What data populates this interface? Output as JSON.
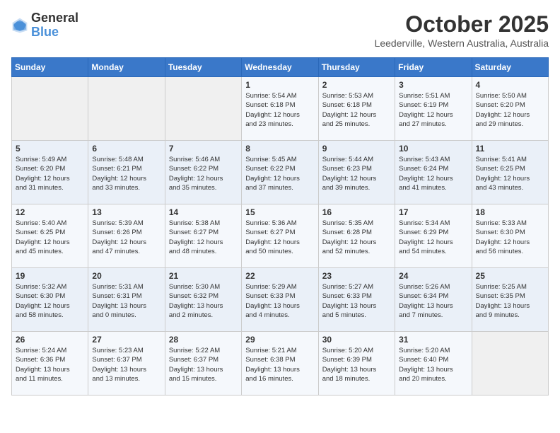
{
  "logo": {
    "text_general": "General",
    "text_blue": "Blue"
  },
  "header": {
    "month": "October 2025",
    "location": "Leederville, Western Australia, Australia"
  },
  "weekdays": [
    "Sunday",
    "Monday",
    "Tuesday",
    "Wednesday",
    "Thursday",
    "Friday",
    "Saturday"
  ],
  "weeks": [
    [
      {
        "day": "",
        "info": ""
      },
      {
        "day": "",
        "info": ""
      },
      {
        "day": "",
        "info": ""
      },
      {
        "day": "1",
        "info": "Sunrise: 5:54 AM\nSunset: 6:18 PM\nDaylight: 12 hours\nand 23 minutes."
      },
      {
        "day": "2",
        "info": "Sunrise: 5:53 AM\nSunset: 6:18 PM\nDaylight: 12 hours\nand 25 minutes."
      },
      {
        "day": "3",
        "info": "Sunrise: 5:51 AM\nSunset: 6:19 PM\nDaylight: 12 hours\nand 27 minutes."
      },
      {
        "day": "4",
        "info": "Sunrise: 5:50 AM\nSunset: 6:20 PM\nDaylight: 12 hours\nand 29 minutes."
      }
    ],
    [
      {
        "day": "5",
        "info": "Sunrise: 5:49 AM\nSunset: 6:20 PM\nDaylight: 12 hours\nand 31 minutes."
      },
      {
        "day": "6",
        "info": "Sunrise: 5:48 AM\nSunset: 6:21 PM\nDaylight: 12 hours\nand 33 minutes."
      },
      {
        "day": "7",
        "info": "Sunrise: 5:46 AM\nSunset: 6:22 PM\nDaylight: 12 hours\nand 35 minutes."
      },
      {
        "day": "8",
        "info": "Sunrise: 5:45 AM\nSunset: 6:22 PM\nDaylight: 12 hours\nand 37 minutes."
      },
      {
        "day": "9",
        "info": "Sunrise: 5:44 AM\nSunset: 6:23 PM\nDaylight: 12 hours\nand 39 minutes."
      },
      {
        "day": "10",
        "info": "Sunrise: 5:43 AM\nSunset: 6:24 PM\nDaylight: 12 hours\nand 41 minutes."
      },
      {
        "day": "11",
        "info": "Sunrise: 5:41 AM\nSunset: 6:25 PM\nDaylight: 12 hours\nand 43 minutes."
      }
    ],
    [
      {
        "day": "12",
        "info": "Sunrise: 5:40 AM\nSunset: 6:25 PM\nDaylight: 12 hours\nand 45 minutes."
      },
      {
        "day": "13",
        "info": "Sunrise: 5:39 AM\nSunset: 6:26 PM\nDaylight: 12 hours\nand 47 minutes."
      },
      {
        "day": "14",
        "info": "Sunrise: 5:38 AM\nSunset: 6:27 PM\nDaylight: 12 hours\nand 48 minutes."
      },
      {
        "day": "15",
        "info": "Sunrise: 5:36 AM\nSunset: 6:27 PM\nDaylight: 12 hours\nand 50 minutes."
      },
      {
        "day": "16",
        "info": "Sunrise: 5:35 AM\nSunset: 6:28 PM\nDaylight: 12 hours\nand 52 minutes."
      },
      {
        "day": "17",
        "info": "Sunrise: 5:34 AM\nSunset: 6:29 PM\nDaylight: 12 hours\nand 54 minutes."
      },
      {
        "day": "18",
        "info": "Sunrise: 5:33 AM\nSunset: 6:30 PM\nDaylight: 12 hours\nand 56 minutes."
      }
    ],
    [
      {
        "day": "19",
        "info": "Sunrise: 5:32 AM\nSunset: 6:30 PM\nDaylight: 12 hours\nand 58 minutes."
      },
      {
        "day": "20",
        "info": "Sunrise: 5:31 AM\nSunset: 6:31 PM\nDaylight: 13 hours\nand 0 minutes."
      },
      {
        "day": "21",
        "info": "Sunrise: 5:30 AM\nSunset: 6:32 PM\nDaylight: 13 hours\nand 2 minutes."
      },
      {
        "day": "22",
        "info": "Sunrise: 5:29 AM\nSunset: 6:33 PM\nDaylight: 13 hours\nand 4 minutes."
      },
      {
        "day": "23",
        "info": "Sunrise: 5:27 AM\nSunset: 6:33 PM\nDaylight: 13 hours\nand 5 minutes."
      },
      {
        "day": "24",
        "info": "Sunrise: 5:26 AM\nSunset: 6:34 PM\nDaylight: 13 hours\nand 7 minutes."
      },
      {
        "day": "25",
        "info": "Sunrise: 5:25 AM\nSunset: 6:35 PM\nDaylight: 13 hours\nand 9 minutes."
      }
    ],
    [
      {
        "day": "26",
        "info": "Sunrise: 5:24 AM\nSunset: 6:36 PM\nDaylight: 13 hours\nand 11 minutes."
      },
      {
        "day": "27",
        "info": "Sunrise: 5:23 AM\nSunset: 6:37 PM\nDaylight: 13 hours\nand 13 minutes."
      },
      {
        "day": "28",
        "info": "Sunrise: 5:22 AM\nSunset: 6:37 PM\nDaylight: 13 hours\nand 15 minutes."
      },
      {
        "day": "29",
        "info": "Sunrise: 5:21 AM\nSunset: 6:38 PM\nDaylight: 13 hours\nand 16 minutes."
      },
      {
        "day": "30",
        "info": "Sunrise: 5:20 AM\nSunset: 6:39 PM\nDaylight: 13 hours\nand 18 minutes."
      },
      {
        "day": "31",
        "info": "Sunrise: 5:20 AM\nSunset: 6:40 PM\nDaylight: 13 hours\nand 20 minutes."
      },
      {
        "day": "",
        "info": ""
      }
    ]
  ]
}
